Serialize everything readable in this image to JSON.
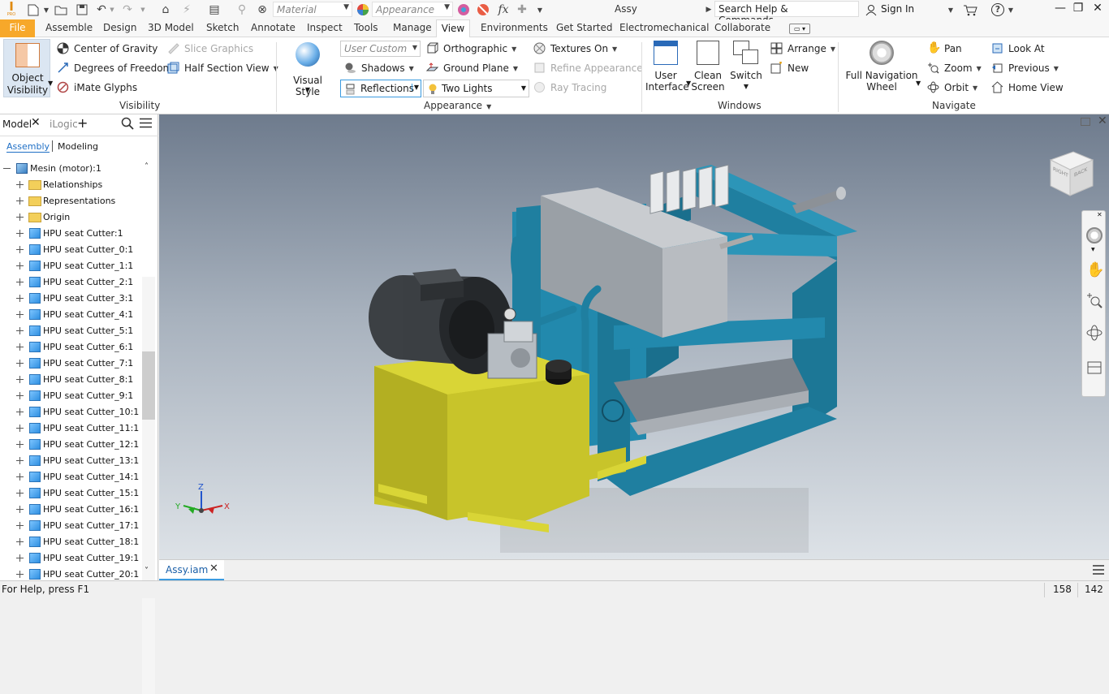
{
  "titlebar": {
    "app_letter": "I",
    "app_sub": "PRO",
    "material_placeholder": "Material",
    "appearance_placeholder": "Appearance",
    "fx_label": "fx",
    "title": "Assy",
    "search_placeholder": "Search Help & Commands...",
    "sign_in": "Sign In",
    "help_label": "?"
  },
  "tabs": [
    "File",
    "Assemble",
    "Design",
    "3D Model",
    "Sketch",
    "Annotate",
    "Inspect",
    "Tools",
    "Manage",
    "View",
    "Environments",
    "Get Started",
    "Electromechanical",
    "Collaborate"
  ],
  "active_tab": "View",
  "ribbon": {
    "visibility": {
      "object_visibility_1": "Object",
      "object_visibility_2": "Visibility",
      "center_of_gravity": "Center of Gravity",
      "degrees_of_freedom": "Degrees of Freedom",
      "imate_glyphs": "iMate Glyphs",
      "slice_graphics": "Slice Graphics",
      "half_section_view": "Half Section View",
      "panel_label": "Visibility"
    },
    "appearance": {
      "visual_style_1": "Visual Style",
      "user_custom": "User Custom",
      "shadows": "Shadows",
      "reflections": "Reflections",
      "orthographic": "Orthographic",
      "ground_plane": "Ground Plane",
      "two_lights": "Two Lights",
      "textures_on": "Textures On",
      "refine_appearance": "Refine Appearance",
      "ray_tracing": "Ray Tracing",
      "panel_label": "Appearance"
    },
    "windows": {
      "user_interface_1": "User",
      "user_interface_2": "Interface",
      "clean_screen_1": "Clean",
      "clean_screen_2": "Screen",
      "switch": "Switch",
      "arrange": "Arrange",
      "new": "New",
      "panel_label": "Windows"
    },
    "navigate": {
      "full_nav_1": "Full Navigation",
      "full_nav_2": "Wheel",
      "pan": "Pan",
      "zoom": "Zoom",
      "orbit": "Orbit",
      "look_at": "Look At",
      "previous": "Previous",
      "home_view": "Home View",
      "panel_label": "Navigate"
    }
  },
  "browser": {
    "tab_model": "Model",
    "tab_ilogic": "iLogic",
    "sub_assembly": "Assembly",
    "sub_modeling": "Modeling",
    "root": "Mesin (motor):1",
    "items": [
      {
        "label": "Relationships",
        "type": "folder"
      },
      {
        "label": "Representations",
        "type": "folder"
      },
      {
        "label": "Origin",
        "type": "folder"
      },
      {
        "label": "HPU seat Cutter:1",
        "type": "part"
      },
      {
        "label": "HPU seat Cutter_0:1",
        "type": "part"
      },
      {
        "label": "HPU seat Cutter_1:1",
        "type": "part"
      },
      {
        "label": "HPU seat Cutter_2:1",
        "type": "part"
      },
      {
        "label": "HPU seat Cutter_3:1",
        "type": "part"
      },
      {
        "label": "HPU seat Cutter_4:1",
        "type": "part"
      },
      {
        "label": "HPU seat Cutter_5:1",
        "type": "part"
      },
      {
        "label": "HPU seat Cutter_6:1",
        "type": "part"
      },
      {
        "label": "HPU seat Cutter_7:1",
        "type": "part"
      },
      {
        "label": "HPU seat Cutter_8:1",
        "type": "part"
      },
      {
        "label": "HPU seat Cutter_9:1",
        "type": "part"
      },
      {
        "label": "HPU seat Cutter_10:1",
        "type": "part"
      },
      {
        "label": "HPU seat Cutter_11:1",
        "type": "part"
      },
      {
        "label": "HPU seat Cutter_12:1",
        "type": "part"
      },
      {
        "label": "HPU seat Cutter_13:1",
        "type": "part"
      },
      {
        "label": "HPU seat Cutter_14:1",
        "type": "part"
      },
      {
        "label": "HPU seat Cutter_15:1",
        "type": "part"
      },
      {
        "label": "HPU seat Cutter_16:1",
        "type": "part"
      },
      {
        "label": "HPU seat Cutter_17:1",
        "type": "part"
      },
      {
        "label": "HPU seat Cutter_18:1",
        "type": "part"
      },
      {
        "label": "HPU seat Cutter_19:1",
        "type": "part"
      },
      {
        "label": "HPU seat Cutter_20:1",
        "type": "part"
      }
    ]
  },
  "viewcube": {
    "face_right": "RIGHT",
    "face_back": "BACK"
  },
  "triad": {
    "x": "X",
    "y": "Y",
    "z": "Z"
  },
  "document_tab": "Assy.iam",
  "status": {
    "help": "For Help, press F1",
    "count_1": "158",
    "count_2": "142"
  },
  "colors": {
    "file_tab": "#f7a82a",
    "frame_blue": "#1f7fa0",
    "hpu_yellow": "#c8c42a",
    "active_doc_underline": "#3b9be0"
  }
}
